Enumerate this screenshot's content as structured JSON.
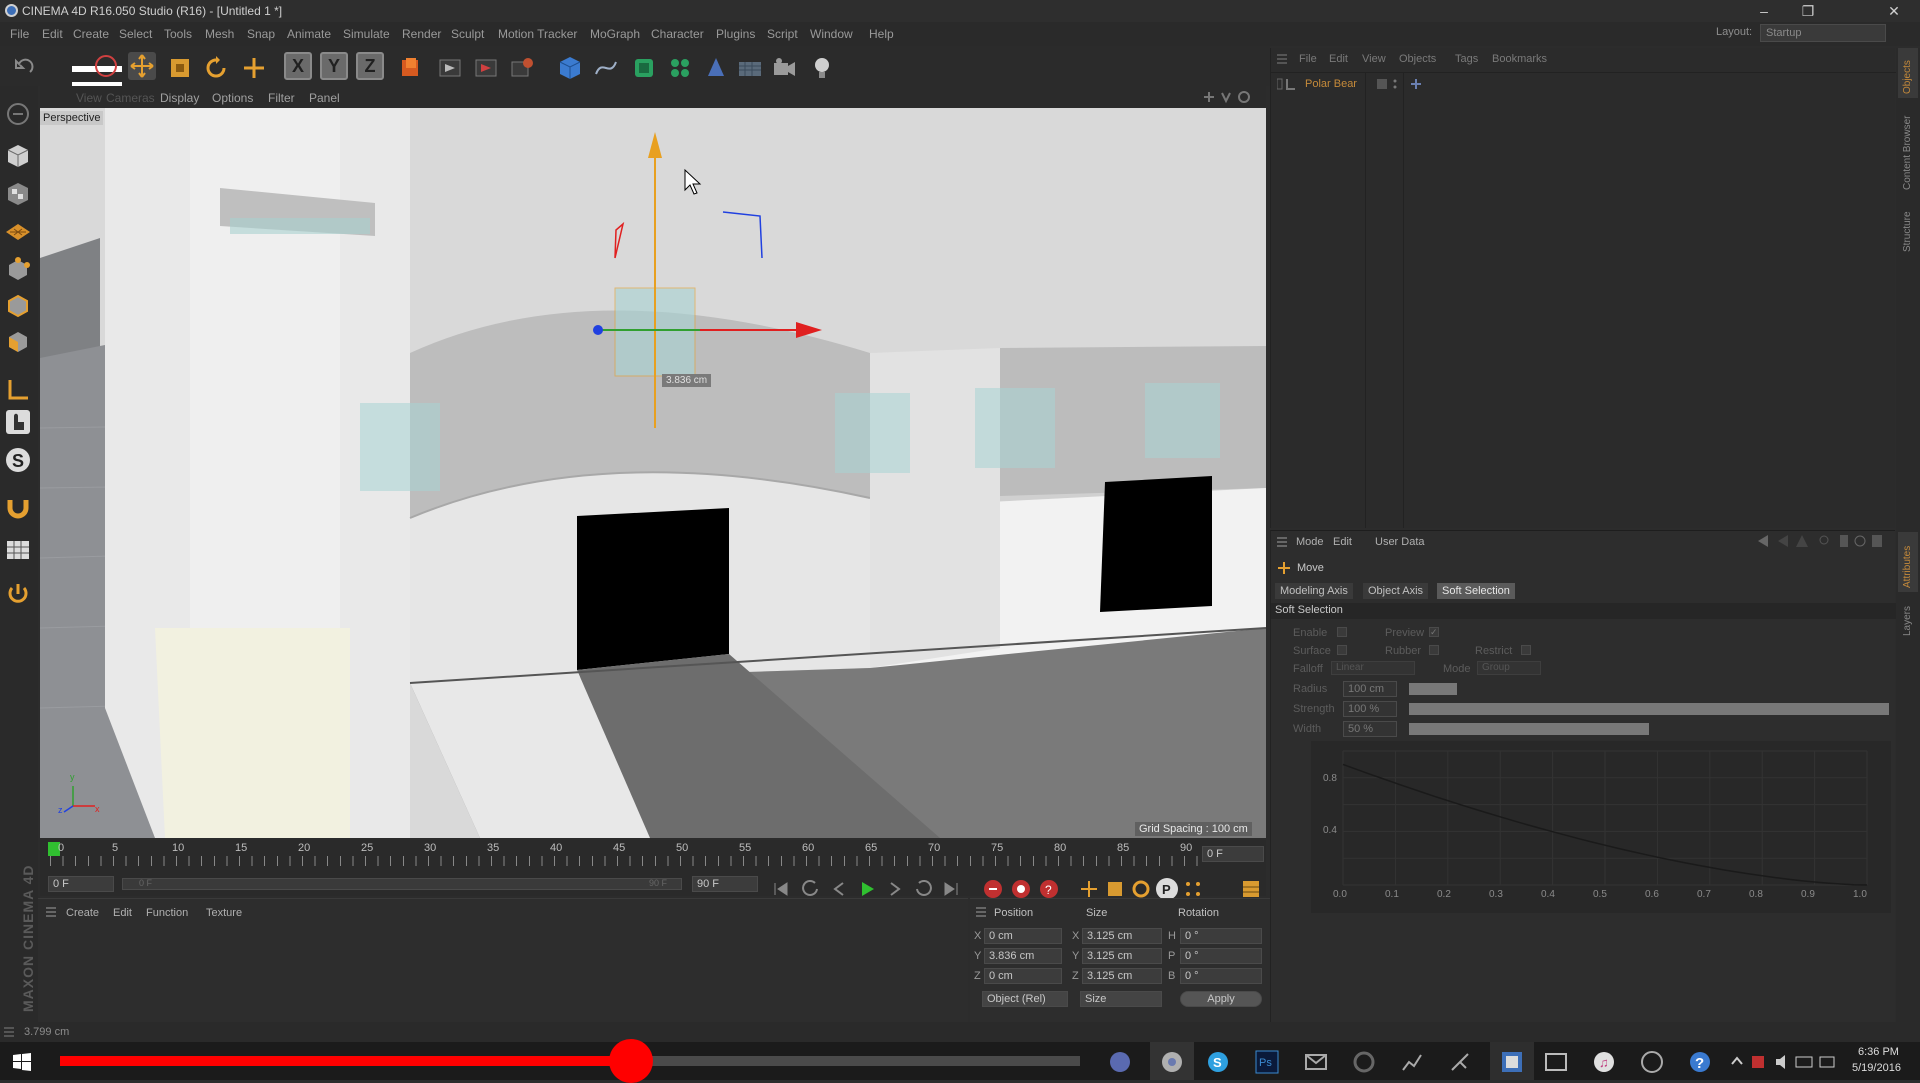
{
  "window": {
    "title": "CINEMA 4D R16.050 Studio (R16) - [Untitled 1 *]",
    "controls": [
      "–",
      "❐",
      "✕"
    ]
  },
  "menubar": {
    "items": [
      "File",
      "Edit",
      "Create",
      "Select",
      "Tools",
      "Mesh",
      "Snap",
      "Animate",
      "Simulate",
      "Render",
      "Sculpt",
      "Motion Tracker",
      "MoGraph",
      "Character",
      "Plugins",
      "Script",
      "Window",
      "Help"
    ],
    "layout_label": "Layout:",
    "layout_value": "Startup"
  },
  "toolbar": {
    "axis_buttons": [
      "X",
      "Y",
      "Z"
    ]
  },
  "viewport": {
    "menu": [
      "View",
      "Cameras",
      "Display",
      "Options",
      "Filter",
      "Panel"
    ],
    "camera_label": "Perspective",
    "handle_readout": "3.836 cm",
    "grid_spacing": "Grid Spacing : 100 cm",
    "axis_labels": {
      "y": "y",
      "z": "z",
      "x": "x"
    }
  },
  "timeline": {
    "ticks": [
      "0",
      "5",
      "10",
      "15",
      "20",
      "25",
      "30",
      "35",
      "40",
      "45",
      "50",
      "55",
      "60",
      "65",
      "70",
      "75",
      "80",
      "85",
      "90"
    ],
    "current_frame": "0 F",
    "start_field": "0 F",
    "range_start": "0 F",
    "range_end": "90 F",
    "end_field": "90 F"
  },
  "material_manager": {
    "menu": [
      "Create",
      "Edit",
      "Function",
      "Texture"
    ]
  },
  "coordinates": {
    "headers": {
      "position": "Position",
      "size": "Size",
      "rotation": "Rotation"
    },
    "rows": [
      {
        "axis": "X",
        "pos": "0 cm",
        "size_axis": "X",
        "size": "3.125 cm",
        "rot_axis": "H",
        "rot": "0 °"
      },
      {
        "axis": "Y",
        "pos": "3.836 cm",
        "size_axis": "Y",
        "size": "3.125 cm",
        "rot_axis": "P",
        "rot": "0 °"
      },
      {
        "axis": "Z",
        "pos": "0 cm",
        "size_axis": "Z",
        "size": "3.125 cm",
        "rot_axis": "B",
        "rot": "0 °"
      }
    ],
    "mode_select": "Object (Rel)",
    "size_select": "Size",
    "apply": "Apply"
  },
  "object_manager": {
    "menu": [
      "File",
      "Edit",
      "View",
      "Objects",
      "Tags",
      "Bookmarks"
    ],
    "objects": [
      {
        "name": "Polar Bear",
        "color": "#c58a3a"
      }
    ]
  },
  "attribute_manager": {
    "menu": [
      "Mode",
      "Edit",
      "User Data"
    ],
    "tool_name": "Move",
    "tabs": [
      "Modeling Axis",
      "Object Axis",
      "Soft Selection"
    ],
    "active_tab": "Soft Selection",
    "section_title": "Soft Selection",
    "options": {
      "enable": "Enable",
      "preview": "Preview",
      "surface": "Surface",
      "rubber": "Rubber",
      "restrict": "Restrict",
      "falloff_label": "Falloff",
      "falloff_value": "Linear",
      "mode_label": "Mode",
      "mode_value": "Group"
    },
    "params": [
      {
        "label": "Radius",
        "value": "100 cm",
        "fill": 0.1
      },
      {
        "label": "Strength",
        "value": "100 %",
        "fill": 1.0
      },
      {
        "label": "Width",
        "value": "50 %",
        "fill": 0.5
      }
    ],
    "curve": {
      "y_ticks": [
        "0.8",
        "0.4"
      ],
      "x_ticks": [
        "0.0",
        "0.1",
        "0.2",
        "0.3",
        "0.4",
        "0.5",
        "0.6",
        "0.7",
        "0.8",
        "0.9",
        "1.0"
      ]
    }
  },
  "right_strip": {
    "tabs": [
      "Objects",
      "Content Browser",
      "Structure",
      "Attributes",
      "Layers"
    ]
  },
  "branding": "MAXON CINEMA 4D",
  "status": "3.799 cm",
  "taskbar": {
    "time": "6:36 PM",
    "date": "5/19/2016",
    "video_progress": 0.56
  },
  "colors": {
    "accent": "#c58a3a",
    "progress": "#ff0000",
    "x_axis": "#e02020",
    "y_axis": "#e8a020",
    "z_axis": "#2040e0"
  }
}
